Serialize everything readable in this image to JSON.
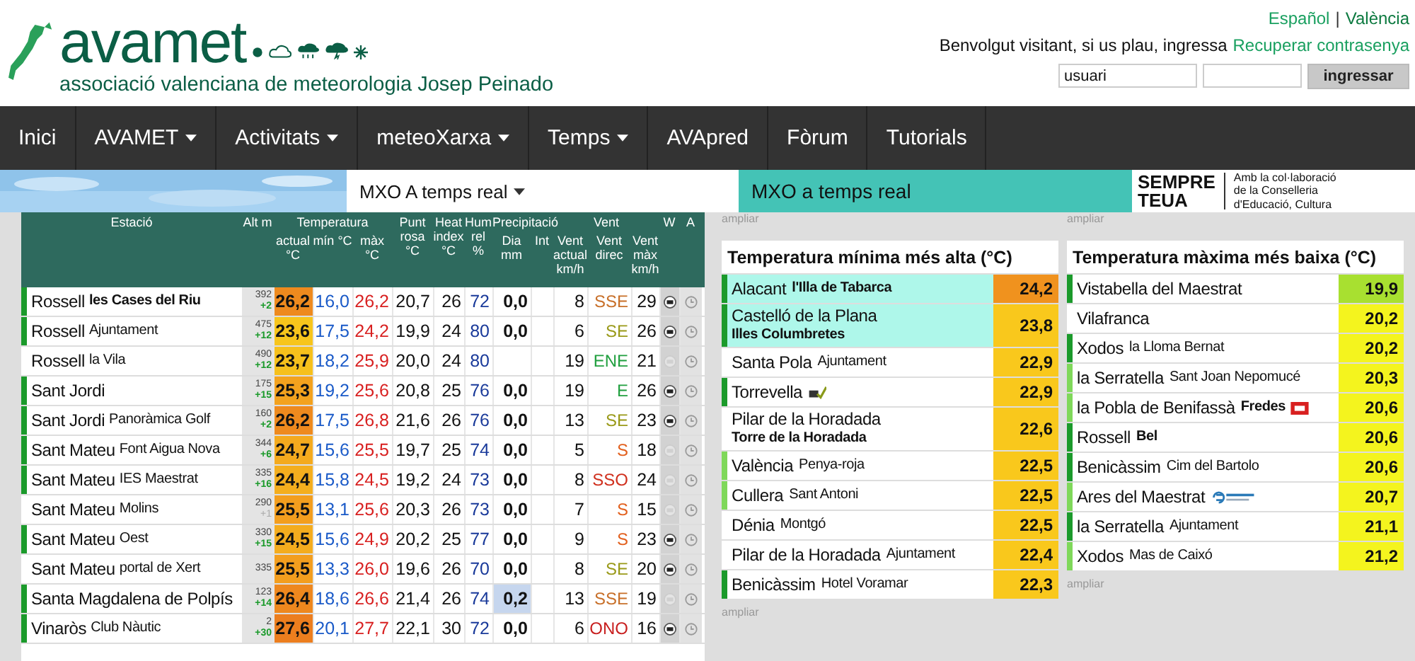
{
  "header": {
    "logo": "avamet",
    "subtitle": "associació valenciana de meteorologia Josep Peinado",
    "languages": [
      {
        "label": "Español",
        "selected": false
      },
      {
        "label": "València",
        "selected": true
      }
    ],
    "language_separator": "|",
    "welcome": "Benvolgut visitant, si us plau, ingressa",
    "recover_link": "Recuperar contrasenya",
    "username": {
      "placeholder": "usuari"
    },
    "login_button": "ingressar"
  },
  "nav": [
    {
      "label": "Inici",
      "dropdown": false
    },
    {
      "label": "AVAMET",
      "dropdown": true
    },
    {
      "label": "Activitats",
      "dropdown": true
    },
    {
      "label": "meteoXarxa",
      "dropdown": true
    },
    {
      "label": "Temps",
      "dropdown": true
    },
    {
      "label": "AVApred",
      "dropdown": false
    },
    {
      "label": "Fòrum",
      "dropdown": false
    },
    {
      "label": "Tutorials",
      "dropdown": false
    }
  ],
  "subbar": {
    "dropdown": "MXO A temps real",
    "tab": "MXO a temps real",
    "ad": {
      "slogan": [
        "SEMPRE",
        "TEUA"
      ],
      "lines": [
        "Amb la col·laboració",
        "de la Conselleria",
        "d'Educació, Cultura"
      ]
    }
  },
  "table": {
    "header": [
      {
        "label": "Estació"
      },
      {
        "label": "Alt m"
      },
      {
        "group": "Temperatura",
        "columns": [
          "actual °C",
          "mín °C",
          "màx °C"
        ]
      },
      {
        "label": "Punt rosa °C"
      },
      {
        "label": "Heat index °C"
      },
      {
        "label": "Hum rel %"
      },
      {
        "group": "Precipitació",
        "columns": [
          "Dia mm",
          "Int"
        ]
      },
      {
        "group": "Vent",
        "columns": [
          "Vent actual km/h",
          "Vent direc",
          "Vent màx km/h"
        ]
      },
      {
        "label": "W"
      },
      {
        "label": "A"
      }
    ],
    "rows": [
      {
        "place": "Rossell",
        "detail": "les Cases del Riu",
        "detail_bold": true,
        "bar": {
          "color": "#1b9a2b"
        },
        "alt": "392",
        "delta": "+2",
        "delta_significant": true,
        "actual": "26,2",
        "color": "#ee8a1e",
        "min": "16,0",
        "max": "26,2",
        "dew": "20,7",
        "heat": "26",
        "hum": "72",
        "precip": "0,0",
        "precip_wet": false,
        "wind": "8",
        "direction": {
          "text": "SSE",
          "color": "#c8702a"
        },
        "gust": "29",
        "w_active": true
      },
      {
        "place": "Rossell",
        "detail": "Ajuntament",
        "detail_bold": false,
        "bar": {
          "color": "#1b9a2b"
        },
        "alt": "475",
        "delta": "+12",
        "delta_significant": true,
        "actual": "23,6",
        "color": "#f7c51c",
        "min": "17,5",
        "max": "24,2",
        "dew": "19,9",
        "heat": "24",
        "hum": "80",
        "precip": "0,0",
        "precip_wet": false,
        "wind": "6",
        "direction": {
          "text": "SE",
          "color": "#9a9a1a"
        },
        "gust": "26",
        "w_active": true
      },
      {
        "place": "Rossell",
        "detail": "la Vila",
        "detail_bold": false,
        "alt": "490",
        "delta": "+12",
        "delta_significant": true,
        "actual": "23,7",
        "color": "#f6c01c",
        "min": "18,2",
        "max": "25,9",
        "dew": "20,0",
        "heat": "24",
        "hum": "80",
        "precip_wet": false,
        "wind": "19",
        "direction": {
          "text": "ENE",
          "color": "#22a040"
        },
        "gust": "21",
        "w_active": false
      },
      {
        "place": "Sant Jordi",
        "bar": {
          "color": "#1b9a2b"
        },
        "alt": "175",
        "delta": "+15",
        "delta_significant": true,
        "actual": "25,3",
        "color": "#f3a21e",
        "min": "19,2",
        "max": "25,6",
        "dew": "20,8",
        "heat": "25",
        "hum": "76",
        "precip": "0,0",
        "precip_wet": false,
        "wind": "19",
        "direction": {
          "text": "E",
          "color": "#22a040"
        },
        "gust": "26",
        "w_active": true
      },
      {
        "place": "Sant Jordi",
        "detail": "Panoràmica Golf",
        "detail_bold": false,
        "bar": {
          "color": "#1b9a2b"
        },
        "alt": "160",
        "delta": "+2",
        "delta_significant": true,
        "actual": "26,2",
        "color": "#ee8a1e",
        "min": "17,5",
        "max": "26,8",
        "dew": "21,6",
        "heat": "26",
        "hum": "76",
        "precip": "0,0",
        "precip_wet": false,
        "wind": "13",
        "direction": {
          "text": "SE",
          "color": "#9a9a1a"
        },
        "gust": "23",
        "w_active": true
      },
      {
        "place": "Sant Mateu",
        "detail": "Font Aigua Nova",
        "detail_bold": false,
        "bar": {
          "color": "#1b9a2b"
        },
        "alt": "344",
        "delta": "+6",
        "delta_significant": true,
        "actual": "24,7",
        "color": "#f4aa1e",
        "min": "15,6",
        "max": "25,5",
        "dew": "19,7",
        "heat": "25",
        "hum": "74",
        "precip": "0,0",
        "precip_wet": false,
        "wind": "5",
        "direction": {
          "text": "S",
          "color": "#e2601e"
        },
        "gust": "18",
        "w_active": false
      },
      {
        "place": "Sant Mateu",
        "detail": "IES Maestrat",
        "detail_bold": false,
        "bar": {
          "color": "#1b9a2b"
        },
        "alt": "335",
        "delta": "+16",
        "delta_significant": true,
        "actual": "24,4",
        "color": "#f4ae1e",
        "min": "15,8",
        "max": "24,5",
        "dew": "19,2",
        "heat": "24",
        "hum": "73",
        "precip": "0,0",
        "precip_wet": false,
        "wind": "8",
        "direction": {
          "text": "SSO",
          "color": "#d0301e"
        },
        "gust": "24",
        "w_active": false
      },
      {
        "place": "Sant Mateu",
        "detail": "Molins",
        "detail_bold": false,
        "alt": "290",
        "delta": "+1",
        "delta_significant": false,
        "actual": "25,5",
        "color": "#f39e1e",
        "min": "13,1",
        "max": "25,6",
        "dew": "20,3",
        "heat": "26",
        "hum": "73",
        "precip": "0,0",
        "precip_wet": false,
        "wind": "7",
        "direction": {
          "text": "S",
          "color": "#e2601e"
        },
        "gust": "15",
        "w_active": false
      },
      {
        "place": "Sant Mateu",
        "detail": "Oest",
        "detail_bold": false,
        "bar": {
          "color": "#1b9a2b"
        },
        "alt": "330",
        "delta": "+15",
        "delta_significant": true,
        "actual": "24,5",
        "color": "#f4ac1e",
        "min": "15,6",
        "max": "24,9",
        "dew": "20,2",
        "heat": "25",
        "hum": "77",
        "precip": "0,0",
        "precip_wet": false,
        "wind": "9",
        "direction": {
          "text": "S",
          "color": "#e2601e"
        },
        "gust": "23",
        "w_active": true
      },
      {
        "place": "Sant Mateu",
        "detail": "portal de Xert",
        "detail_bold": false,
        "alt": "335",
        "actual": "25,5",
        "color": "#f39e1e",
        "min": "13,3",
        "max": "26,0",
        "dew": "19,6",
        "heat": "26",
        "hum": "70",
        "precip": "0,0",
        "precip_wet": false,
        "wind": "8",
        "direction": {
          "text": "SE",
          "color": "#9a9a1a"
        },
        "gust": "20",
        "w_active": true
      },
      {
        "place": "Santa Magdalena de Polpís",
        "bar": {
          "color": "#1b9a2b"
        },
        "alt": "123",
        "delta": "+14",
        "delta_significant": true,
        "actual": "26,4",
        "color": "#ee881e",
        "min": "18,6",
        "max": "26,6",
        "dew": "21,4",
        "heat": "26",
        "hum": "74",
        "precip": "0,2",
        "precip_wet": true,
        "wind": "13",
        "direction": {
          "text": "SSE",
          "color": "#c8702a"
        },
        "gust": "19",
        "w_active": false
      },
      {
        "place": "Vinaròs",
        "detail": "Club Nàutic",
        "detail_bold": false,
        "bar": {
          "color": "#1b9a2b"
        },
        "alt": "2",
        "delta": "+30",
        "delta_significant": true,
        "actual": "27,6",
        "color": "#ec7e1e",
        "min": "20,1",
        "max": "27,7",
        "dew": "22,1",
        "heat": "30",
        "hum": "72",
        "precip": "0,0",
        "precip_wet": false,
        "wind": "6",
        "direction": {
          "text": "ONO",
          "color": "#c82020"
        },
        "gust": "16",
        "w_active": true
      }
    ]
  },
  "panels": [
    {
      "expand_link_above": "ampliar",
      "title": "Temperatura mínima més alta (°C)",
      "expand_link_below": "ampliar",
      "rows": [
        {
          "kind": "plain",
          "place": "Alacant",
          "detail": "l'Illa de Tabarca",
          "detail_bold": true,
          "bar": {
            "color": "#1b9a2b"
          },
          "highlight": true,
          "value": "24,2",
          "color": "#f0921e"
        },
        {
          "kind": "plain",
          "place": "Castelló de la Plana",
          "detail": "Illes Columbretes",
          "detail_bold": true,
          "bar": {
            "color": "#1b9a2b"
          },
          "highlight": true,
          "value": "23,8",
          "color": "#f9c81c"
        },
        {
          "kind": "plain",
          "place": "Santa Pola",
          "detail": "Ajuntament",
          "detail_bold": false,
          "highlight": false,
          "value": "22,9",
          "color": "#f9c81c"
        },
        {
          "kind": "checkmark",
          "place": "Torrevella",
          "bar": {
            "color": "#1b9a2b"
          },
          "highlight": false,
          "value": "22,9",
          "color": "#f9c81c"
        },
        {
          "kind": "plain",
          "place": "Pilar de la Horadada",
          "detail": "Torre de la Horadada",
          "detail_bold": true,
          "highlight": false,
          "value": "22,6",
          "color": "#f9c81c"
        },
        {
          "kind": "plain",
          "place": "València",
          "detail": "Penya-roja",
          "detail_bold": false,
          "bar": {
            "color": "#7fd85a"
          },
          "highlight": false,
          "value": "22,5",
          "color": "#f9c81c"
        },
        {
          "kind": "plain",
          "place": "Cullera",
          "detail": "Sant Antoni",
          "detail_bold": false,
          "bar": {
            "color": "#7fd85a"
          },
          "highlight": false,
          "value": "22,5",
          "color": "#f9c81c"
        },
        {
          "kind": "plain",
          "place": "Dénia",
          "detail": "Montgó",
          "detail_bold": false,
          "highlight": false,
          "value": "22,5",
          "color": "#f9c81c"
        },
        {
          "kind": "plain",
          "place": "Pilar de la Horadada",
          "detail": "Ajuntament",
          "detail_bold": false,
          "highlight": false,
          "value": "22,4",
          "color": "#f9c81c"
        },
        {
          "kind": "plain",
          "place": "Benicàssim",
          "detail": "Hotel Voramar",
          "detail_bold": false,
          "bar": {
            "color": "#1b9a2b"
          },
          "highlight": false,
          "value": "22,3",
          "color": "#f9c81c"
        }
      ]
    },
    {
      "expand_link_above": "ampliar",
      "title": "Temperatura màxima més baixa (°C)",
      "expand_link_below": "ampliar",
      "rows": [
        {
          "kind": "plain",
          "place": "Vistabella del Maestrat",
          "bar": {
            "color": "#1b9a2b"
          },
          "highlight": false,
          "value": "19,9",
          "color": "#a8e030"
        },
        {
          "kind": "plain",
          "place": "Vilafranca",
          "highlight": false,
          "value": "20,2",
          "color": "#f4f41e"
        },
        {
          "kind": "plain",
          "place": "Xodos",
          "detail": "la Lloma Bernat",
          "detail_bold": false,
          "bar": {
            "color": "#1b9a2b"
          },
          "highlight": false,
          "value": "20,2",
          "color": "#f4f41e"
        },
        {
          "kind": "plain",
          "place": "la Serratella",
          "detail": "Sant Joan Nepomucé",
          "detail_bold": false,
          "bar": {
            "color": "#7fd85a"
          },
          "highlight": false,
          "value": "20,3",
          "color": "#f4f41e"
        },
        {
          "kind": "badge",
          "place": "la Pobla de Benifassà",
          "detail": "Fredes",
          "detail_bold": true,
          "bar": {
            "color": "#7fd85a"
          },
          "highlight": false,
          "value": "20,6",
          "color": "#f4f41e"
        },
        {
          "kind": "plain",
          "place": "Rossell",
          "detail": "Bel",
          "detail_bold": true,
          "bar": {
            "color": "#1b9a2b"
          },
          "highlight": false,
          "value": "20,6",
          "color": "#f4f41e"
        },
        {
          "kind": "plain",
          "place": "Benicàssim",
          "detail": "Cim del Bartolo",
          "detail_bold": false,
          "bar": {
            "color": "#1b9a2b"
          },
          "highlight": false,
          "value": "20,6",
          "color": "#f4f41e"
        },
        {
          "kind": "wave",
          "place": "Ares del Maestrat",
          "bar": {
            "color": "#7fd85a"
          },
          "highlight": false,
          "value": "20,7",
          "color": "#f4f41e"
        },
        {
          "kind": "plain",
          "place": "la Serratella",
          "detail": "Ajuntament",
          "detail_bold": false,
          "bar": {
            "color": "#1b9a2b"
          },
          "highlight": false,
          "value": "21,1",
          "color": "#f4f41e"
        },
        {
          "kind": "plain",
          "place": "Xodos",
          "detail": "Mas de Caixó",
          "detail_bold": false,
          "bar": {
            "color": "#7fd85a"
          },
          "highlight": false,
          "value": "21,2",
          "color": "#f4f41e"
        }
      ]
    }
  ]
}
